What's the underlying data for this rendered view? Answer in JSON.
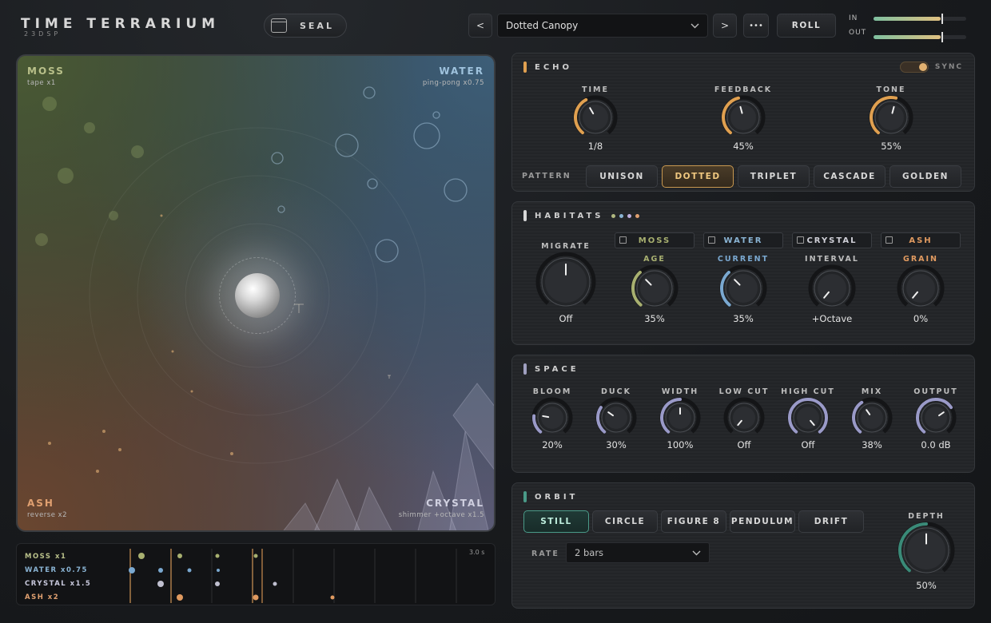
{
  "header": {
    "title": "TIME TERRARIUM",
    "subtitle": "23DSP",
    "seal_label": "SEAL",
    "prev_label": "<",
    "next_label": ">",
    "preset_name": "Dotted Canopy",
    "more_label": "•••",
    "roll_label": "ROLL",
    "meters": [
      {
        "label": "IN",
        "level": 0.72
      },
      {
        "label": "OUT",
        "level": 0.72
      }
    ]
  },
  "terrarium": {
    "corners": [
      {
        "title": "MOSS",
        "sub": "tape  x1",
        "color": "#b9c08a"
      },
      {
        "title": "WATER",
        "sub": "ping-pong  x0.75",
        "color": "#9fc3de"
      },
      {
        "title": "ASH",
        "sub": "reverse  x2",
        "color": "#e0a070"
      },
      {
        "title": "CRYSTAL",
        "sub": "shimmer +octave  x1.5",
        "color": "#d0d0e0"
      }
    ]
  },
  "timeline": {
    "duration": "3.0 s",
    "rows": [
      {
        "label": "MOSS  x1",
        "color": "#b9c08a"
      },
      {
        "label": "WATER  x0.75",
        "color": "#8ab4d4"
      },
      {
        "label": "CRYSTAL  x1.5",
        "color": "#c8c8dc"
      },
      {
        "label": "ASH  x2",
        "color": "#e0a070"
      }
    ]
  },
  "echo": {
    "title": "ECHO",
    "sync_label": "SYNC",
    "knobs": [
      {
        "label": "TIME",
        "value": "1/8"
      },
      {
        "label": "FEEDBACK",
        "value": "45%"
      },
      {
        "label": "TONE",
        "value": "55%"
      }
    ],
    "pattern_label": "PATTERN",
    "patterns": [
      "UNISON",
      "DOTTED",
      "TRIPLET",
      "CASCADE",
      "GOLDEN"
    ],
    "selected_pattern": "DOTTED"
  },
  "habitats": {
    "title": "HABITATS",
    "dot_colors": [
      "#b0b880",
      "#8ab4d4",
      "#c0b0e0",
      "#e0a070"
    ],
    "migrate": {
      "label": "MIGRATE",
      "value": "Off"
    },
    "buttons": [
      {
        "label": "MOSS",
        "color": "#a8b070"
      },
      {
        "label": "WATER",
        "color": "#8ab4d4"
      },
      {
        "label": "CRYSTAL",
        "color": "#d0d0d8"
      },
      {
        "label": "ASH",
        "color": "#e09a60"
      }
    ],
    "knobs": [
      {
        "label": "AGE",
        "value": "35%",
        "color": "#a8b070"
      },
      {
        "label": "CURRENT",
        "value": "35%",
        "color": "#7aa8d0"
      },
      {
        "label": "INTERVAL",
        "value": "+Octave",
        "color": "#c0c0c8"
      },
      {
        "label": "GRAIN",
        "value": "0%",
        "color": "#e09a60"
      }
    ]
  },
  "space": {
    "title": "SPACE",
    "knobs": [
      {
        "label": "BLOOM",
        "value": "20%"
      },
      {
        "label": "DUCK",
        "value": "30%"
      },
      {
        "label": "WIDTH",
        "value": "100%"
      },
      {
        "label": "LOW CUT",
        "value": "Off"
      },
      {
        "label": "HIGH CUT",
        "value": "Off"
      },
      {
        "label": "MIX",
        "value": "38%"
      },
      {
        "label": "OUTPUT",
        "value": "0.0 dB"
      }
    ]
  },
  "orbit": {
    "title": "ORBIT",
    "modes": [
      "STILL",
      "CIRCLE",
      "FIGURE 8",
      "PENDULUM",
      "DRIFT"
    ],
    "selected_mode": "STILL",
    "rate_label": "RATE",
    "rate_value": "2 bars",
    "depth": {
      "label": "DEPTH",
      "value": "50%"
    }
  }
}
